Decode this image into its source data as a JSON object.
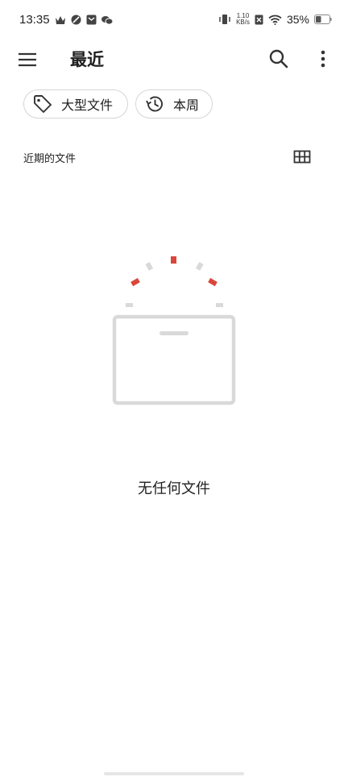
{
  "status_bar": {
    "time": "13:35",
    "speed_top": "1.10",
    "speed_bottom": "KB/s",
    "battery": "35%"
  },
  "app_bar": {
    "title": "最近"
  },
  "filters": {
    "large_files": "大型文件",
    "this_week": "本周"
  },
  "section": {
    "title": "近期的文件"
  },
  "empty_state": {
    "message": "无任何文件"
  },
  "colors": {
    "accent_red": "#d9473b",
    "illustration_gray": "#d9d9d9"
  }
}
